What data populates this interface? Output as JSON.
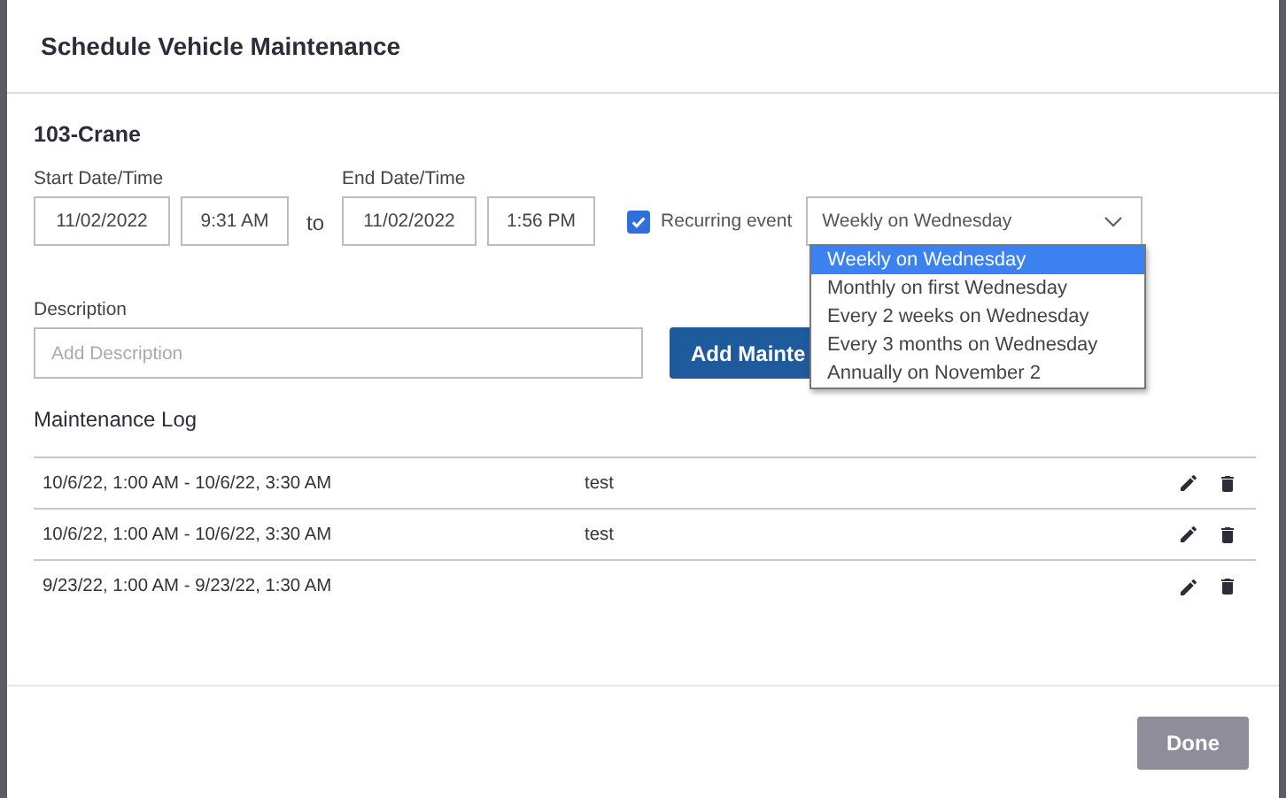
{
  "dialog": {
    "title": "Schedule Vehicle Maintenance"
  },
  "vehicle": "103-Crane",
  "start": {
    "label": "Start Date/Time",
    "date": "11/02/2022",
    "time": "9:31 AM"
  },
  "separator": "to",
  "end": {
    "label": "End Date/Time",
    "date": "11/02/2022",
    "time": "1:56 PM"
  },
  "recurring": {
    "label": "Recurring event",
    "checked": true,
    "value": "Weekly on Wednesday",
    "options": [
      {
        "label": "Weekly on Wednesday",
        "selected": true
      },
      {
        "label": "Monthly on first Wednesday",
        "selected": false
      },
      {
        "label": "Every 2 weeks on Wednesday",
        "selected": false
      },
      {
        "label": "Every 3 months on Wednesday",
        "selected": false
      },
      {
        "label": "Annually on November 2",
        "selected": false
      }
    ]
  },
  "description": {
    "label": "Description",
    "placeholder": "Add Description"
  },
  "add_button": "Add Mainte",
  "log": {
    "title": "Maintenance Log",
    "rows": [
      {
        "range": "10/6/22, 1:00 AM - 10/6/22, 3:30 AM",
        "description": "test"
      },
      {
        "range": "10/6/22, 1:00 AM - 10/6/22, 3:30 AM",
        "description": "test"
      },
      {
        "range": "9/23/22, 1:00 AM - 9/23/22, 1:30 AM"
      }
    ]
  },
  "done_button": "Done"
}
